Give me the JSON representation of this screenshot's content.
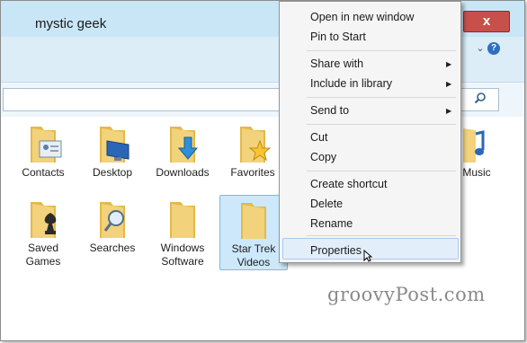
{
  "window": {
    "title": "mystic geek",
    "close_label": "x",
    "help_label": "?"
  },
  "items": [
    {
      "label": "Contacts"
    },
    {
      "label": "Desktop"
    },
    {
      "label": "Downloads"
    },
    {
      "label": "Favorites"
    },
    {
      "label": "Music"
    },
    {
      "label": "Saved Games"
    },
    {
      "label": "Searches"
    },
    {
      "label": "Windows Software"
    },
    {
      "label": "Star Trek Videos",
      "selected": true
    }
  ],
  "context_menu": {
    "open_new_window": "Open in new window",
    "pin_to_start": "Pin to Start",
    "share_with": "Share with",
    "include_in_library": "Include in library",
    "send_to": "Send to",
    "cut": "Cut",
    "copy": "Copy",
    "create_shortcut": "Create shortcut",
    "delete": "Delete",
    "rename": "Rename",
    "properties": "Properties"
  },
  "watermark": "groovyPost.com",
  "colors": {
    "titlebar": "#c9e6f6",
    "close_button": "#c7504b",
    "selection": "#cde8fb",
    "folder": "#f2cf6a"
  }
}
